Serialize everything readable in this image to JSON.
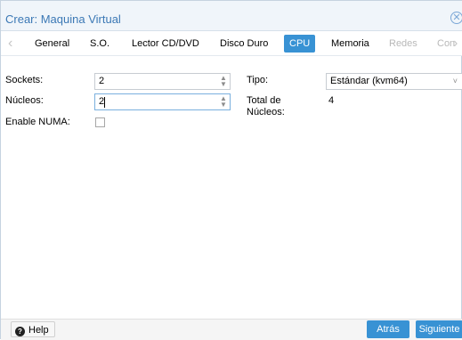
{
  "window": {
    "title": "Crear: Maquina Virtual",
    "close_glyph": "✕"
  },
  "tabs": [
    {
      "label": "General",
      "state": "normal"
    },
    {
      "label": "S.O.",
      "state": "normal"
    },
    {
      "label": "Lector CD/DVD",
      "state": "normal"
    },
    {
      "label": "Disco Duro",
      "state": "normal"
    },
    {
      "label": "CPU",
      "state": "active"
    },
    {
      "label": "Memoria",
      "state": "normal"
    },
    {
      "label": "Redes",
      "state": "disabled"
    },
    {
      "label": "Con",
      "state": "disabled"
    }
  ],
  "tab_scroll": {
    "left_icon": "chevron-left-icon",
    "right_icon": "chevron-right-icon",
    "left_glyph": "‹",
    "right_glyph": "›"
  },
  "form": {
    "sockets_label": "Sockets:",
    "sockets_value": "2",
    "cores_label": "Núcleos:",
    "cores_value": "2",
    "numa_label": "Enable NUMA:",
    "numa_checked": false,
    "type_label": "Tipo:",
    "type_value": "Estándar (kvm64)",
    "total_label_line1": "Total de",
    "total_label_line2": "Núcleos:",
    "total_value": "4",
    "spinner_up": "▲",
    "spinner_down": "▼",
    "combo_arrow": "˅"
  },
  "footer": {
    "help_label": "Help",
    "help_icon_glyph": "?",
    "back_label": "Atrás",
    "next_label": "Siguiente"
  },
  "colors": {
    "accent": "#3892d4",
    "title_text": "#3b78b5",
    "titlebar_bg": "#f0f5fa"
  }
}
